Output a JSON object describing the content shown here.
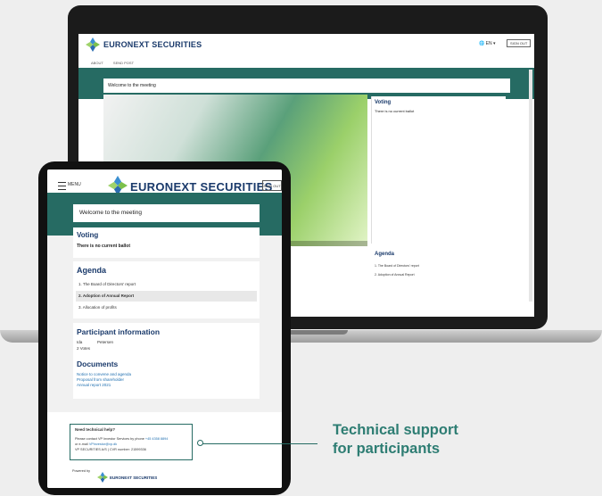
{
  "brand": "EURONEXT SECURITIES",
  "laptop": {
    "lang": "EN",
    "signout": "SIGN OUT",
    "nav": [
      "ABOUT",
      "SEND POST"
    ],
    "welcome": "Welcome to the meeting",
    "voting_title": "Voting",
    "voting_text": "There is no current ballot",
    "agenda_title": "Agenda",
    "agenda_items": [
      "1. The Board of Directors' report",
      "2. Adoption of Annual Report"
    ]
  },
  "tablet": {
    "menu_label": "MENU",
    "signout": "SIGN OUT",
    "welcome": "Welcome to the meeting",
    "voting_title": "Voting",
    "voting_text": "There is no current ballot",
    "agenda_title": "Agenda",
    "agenda_items": [
      "1. The Board of Directors' report",
      "2. Adoption of Annual Report",
      "3. Allocation of profits"
    ],
    "participant_title": "Participant information",
    "participant_name_first": "Ida",
    "participant_name_last": "Petersen",
    "participant_votes": "2 Votes",
    "documents_title": "Documents",
    "documents": [
      "Notice to convene and agenda",
      "Proposal from shareholder",
      "Annual report 2021"
    ],
    "help_title": "Need technical help?",
    "help_line1": "Please contact VP Investor Services by phone",
    "help_phone": "+45 4358 8894",
    "help_line2": "or e-mail",
    "help_email": "VPinvestor@vp.dk",
    "help_line3": "VP SECURITIES A/S | CVR number: 21599336",
    "powered_by": "Powered by"
  },
  "callout": {
    "line1": "Technical support",
    "line2": "for participants"
  },
  "colors": {
    "teal": "#266b63",
    "navy": "#1a3a6b",
    "callout": "#2e7d73"
  }
}
